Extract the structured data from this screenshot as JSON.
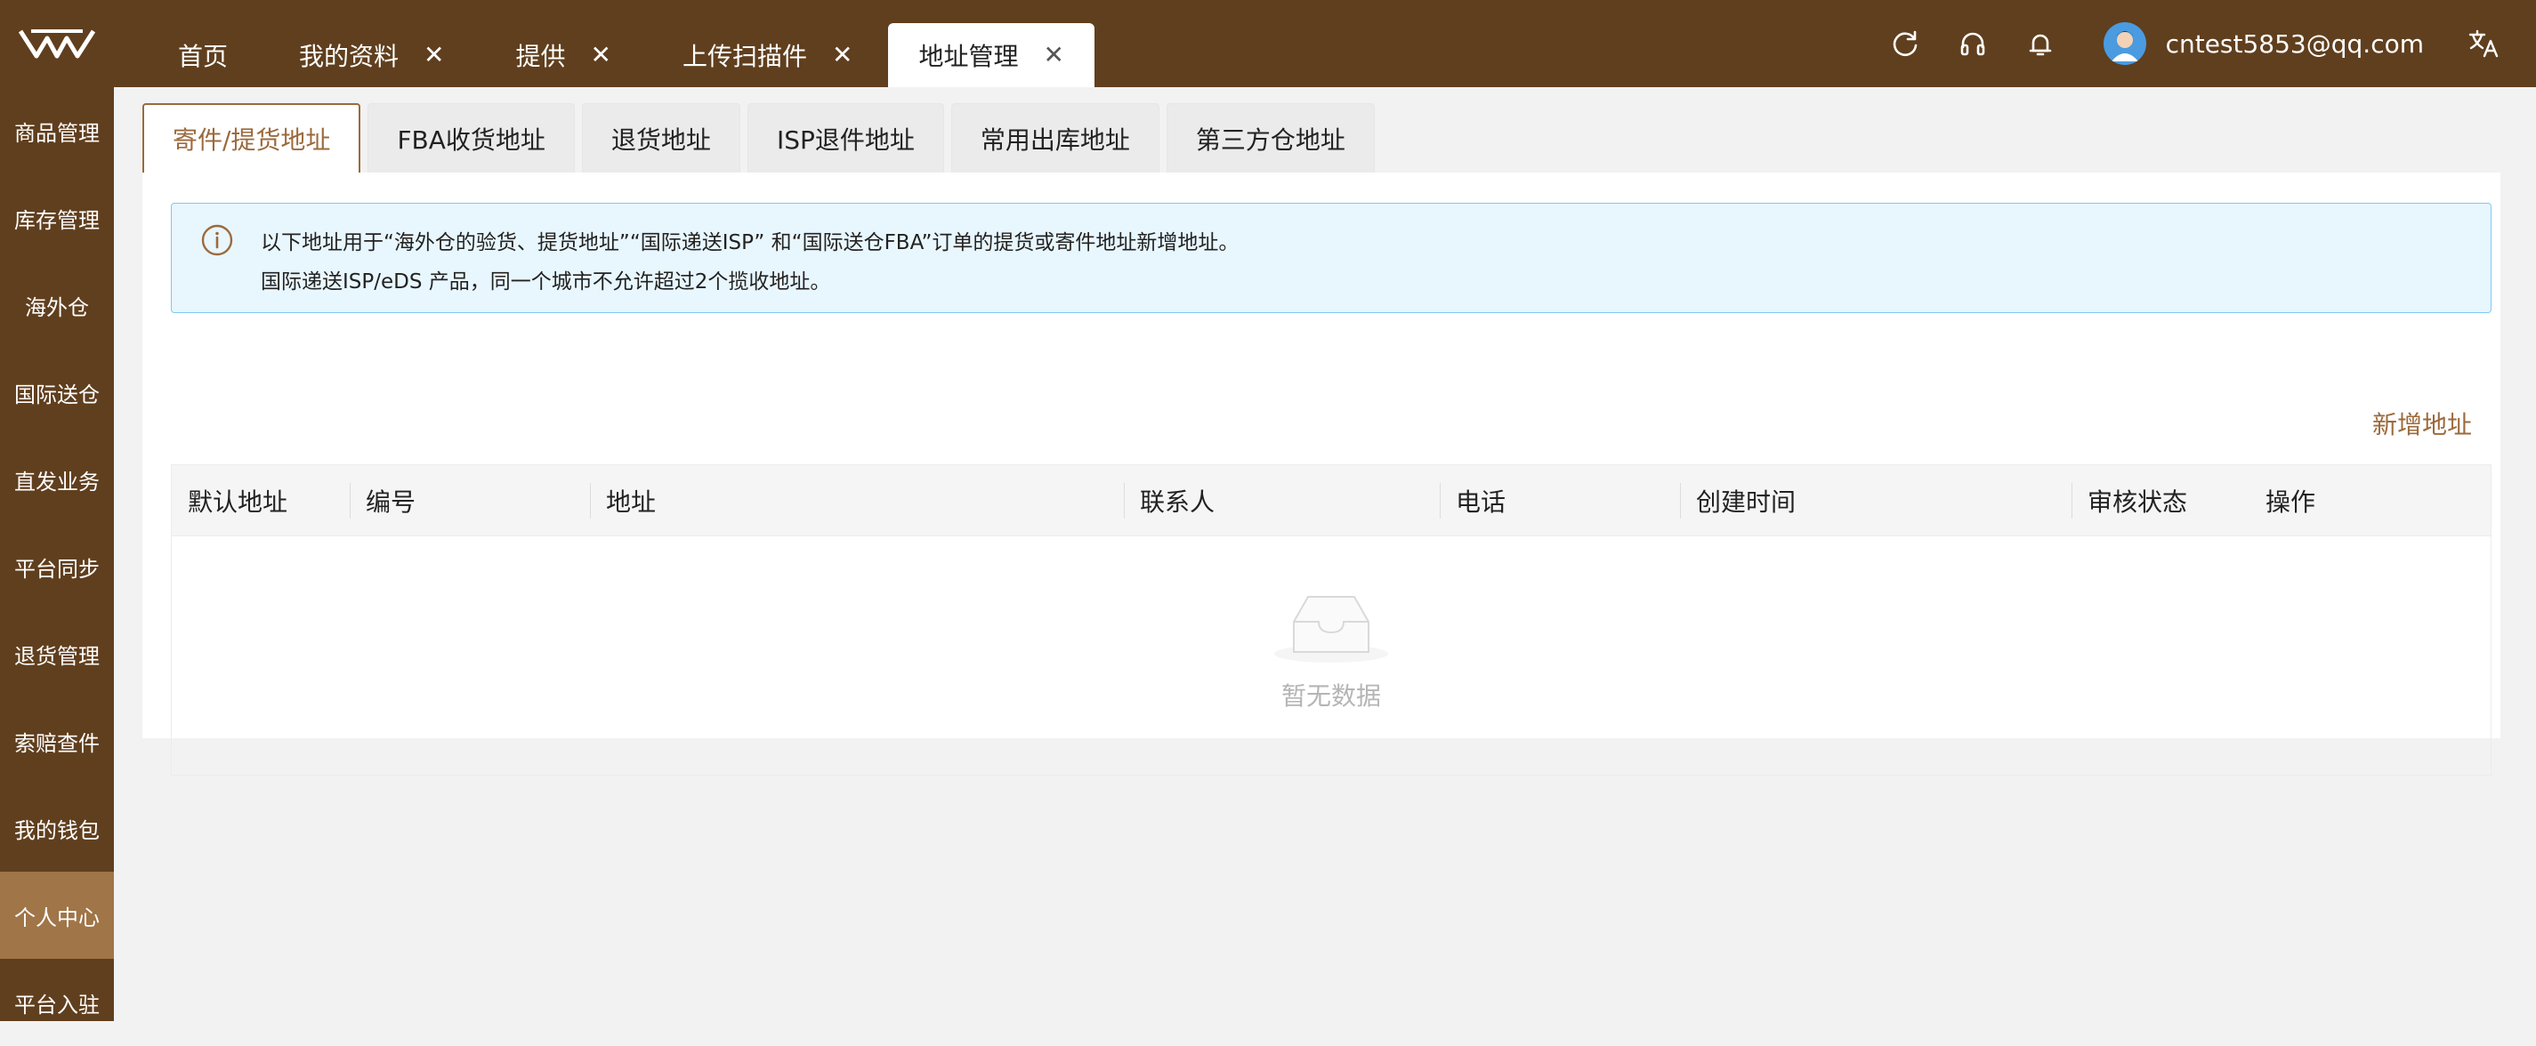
{
  "header": {
    "tabs": [
      {
        "label": "首页",
        "closable": false,
        "active": false
      },
      {
        "label": "我的资料",
        "closable": true,
        "active": false
      },
      {
        "label": "提供",
        "closable": true,
        "active": false
      },
      {
        "label": "上传扫描件",
        "closable": true,
        "active": false
      },
      {
        "label": "地址管理",
        "closable": true,
        "active": true
      }
    ],
    "icons": [
      "refresh-icon",
      "headset-icon",
      "bell-icon",
      "translate-icon"
    ],
    "user_email": "cntest5853@qq.com"
  },
  "sidebar": {
    "items": [
      {
        "label": "商品管理",
        "active": false
      },
      {
        "label": "库存管理",
        "active": false
      },
      {
        "label": "海外仓",
        "active": false
      },
      {
        "label": "国际送仓",
        "active": false
      },
      {
        "label": "直发业务",
        "active": false
      },
      {
        "label": "平台同步",
        "active": false
      },
      {
        "label": "退货管理",
        "active": false
      },
      {
        "label": "索赔查件",
        "active": false
      },
      {
        "label": "我的钱包",
        "active": false
      },
      {
        "label": "个人中心",
        "active": true
      },
      {
        "label": "平台入驻",
        "active": false
      }
    ]
  },
  "main": {
    "subtabs": [
      {
        "label": "寄件/提货地址",
        "active": true
      },
      {
        "label": "FBA收货地址",
        "active": false
      },
      {
        "label": "退货地址",
        "active": false
      },
      {
        "label": "ISP退件地址",
        "active": false
      },
      {
        "label": "常用出库地址",
        "active": false
      },
      {
        "label": "第三方仓地址",
        "active": false
      }
    ],
    "notice": {
      "line1": "以下地址用于“海外仓的验货、提货地址”“国际递送ISP” 和“国际送仓FBA”订单的提货或寄件地址新增地址。",
      "line2": "国际递送ISP/eDS 产品，同一个城市不允许超过2个揽收地址。"
    },
    "add_address": "新增地址",
    "table": {
      "columns": [
        "默认地址",
        "编号",
        "地址",
        "联系人",
        "电话",
        "创建时间",
        "审核状态",
        "操作"
      ],
      "rows": [],
      "empty_text": "暂无数据"
    }
  },
  "colors": {
    "brand": "#603f1e",
    "accent": "#9b6a3c",
    "sidebar_active": "#a07548",
    "notice_bg": "#e8f6fd"
  }
}
